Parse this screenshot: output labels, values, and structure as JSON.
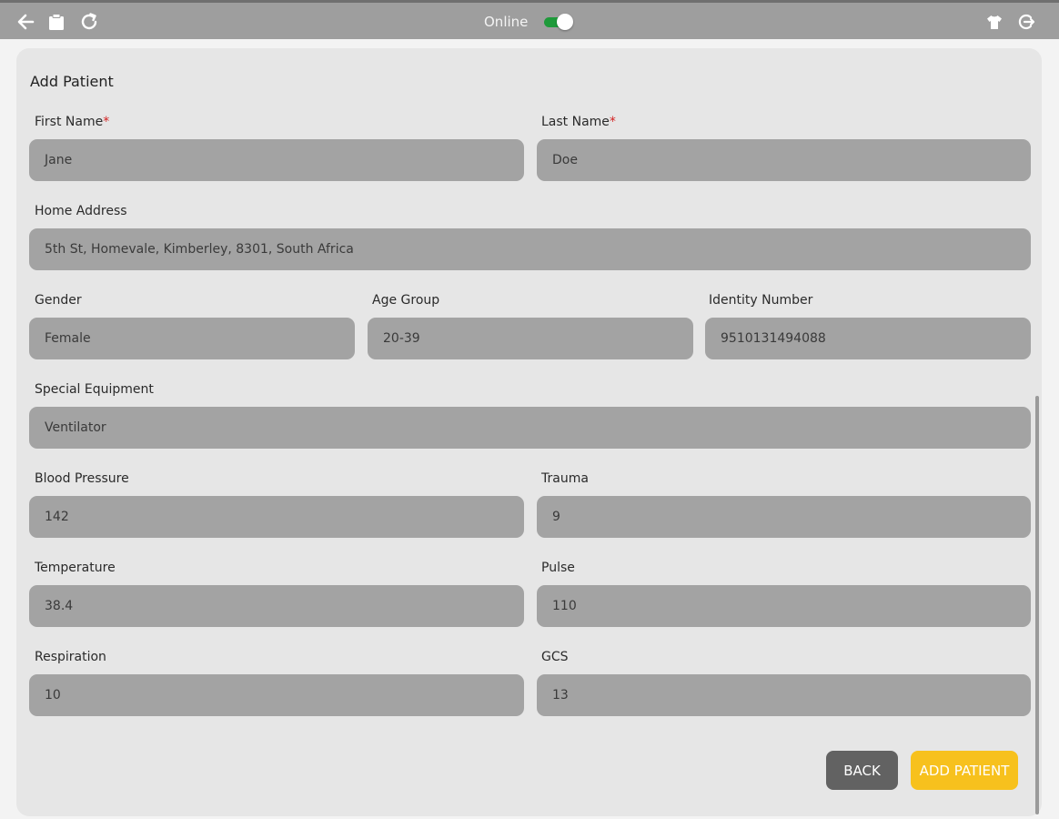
{
  "toolbar": {
    "online_label": "Online",
    "online_toggle_on": true,
    "toggle_color": "#1e9a3a",
    "icons": [
      "back-arrow-icon",
      "clipboard-icon",
      "refresh-icon",
      "shirt-icon",
      "logout-icon"
    ]
  },
  "form": {
    "title": "Add Patient",
    "required_marker": "*",
    "first_name": {
      "label": "First Name",
      "value": "Jane"
    },
    "last_name": {
      "label": "Last Name",
      "value": "Doe"
    },
    "home_address": {
      "label": "Home Address",
      "value": "5th St, Homevale, Kimberley, 8301, South Africa"
    },
    "gender": {
      "label": "Gender",
      "value": "Female"
    },
    "age_group": {
      "label": "Age Group",
      "value": "20-39"
    },
    "identity_number": {
      "label": "Identity Number",
      "value": "9510131494088"
    },
    "special_equipment": {
      "label": "Special Equipment",
      "value": "Ventilator"
    },
    "blood_pressure": {
      "label": "Blood Pressure",
      "value": "142"
    },
    "trauma": {
      "label": "Trauma",
      "value": "9"
    },
    "temperature": {
      "label": "Temperature",
      "value": "38.4"
    },
    "pulse": {
      "label": "Pulse",
      "value": "110"
    },
    "respiration": {
      "label": "Respiration",
      "value": "10"
    },
    "gcs": {
      "label": "GCS",
      "value": "13"
    }
  },
  "buttons": {
    "back": "BACK",
    "add_patient": "ADD PATIENT",
    "add_color": "#f7c11d",
    "back_color": "#626262"
  }
}
